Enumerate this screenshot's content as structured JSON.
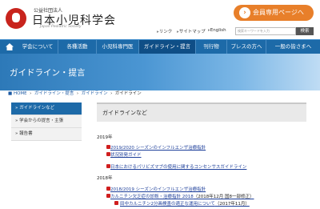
{
  "header": {
    "org_sub": "公益社団法人",
    "org_name": "日本小児科学会",
    "org_en": "Japan Pediatric Society",
    "members_button": "会員専用ページへ",
    "util_links": [
      "リンク",
      "サイトマップ",
      "English"
    ],
    "search_placeholder": "検索キーワードを入力",
    "search_button": "検索"
  },
  "nav": {
    "items": [
      "学会について",
      "各種活動",
      "小児科専門医",
      "ガイドライン・提言",
      "刊行物",
      "プレスの方へ",
      "一般の皆さまへ"
    ]
  },
  "banner": {
    "title": "ガイドライン・提言"
  },
  "breadcrumb": [
    "HOME",
    "ガイドライン・提言",
    "ガイドライン",
    "ガイドライン"
  ],
  "sidebar": {
    "items": [
      "ガイドラインなど",
      "学会からの提言・主張",
      "報告書"
    ]
  },
  "content": {
    "title": "ガイドラインなど",
    "sections": [
      {
        "year": "2019年",
        "entries": [
          {
            "link": "2019/2020 シーズンのインフルエンザ治療指針",
            "note": ""
          },
          {
            "link": "状況別発ガイド",
            "note": ""
          },
          {
            "link": "日本におけるパリビズマブの使用に関するコンセンサスガイドライン",
            "note": ""
          }
        ]
      },
      {
        "year": "2018年",
        "entries": [
          {
            "link": "2018/2019 シーズンのインフルエンザ治療指針",
            "note": ""
          },
          {
            "link": "カルニチン欠乏症の診断・治療指針 2018",
            "note": "（2018年12月 国8一部修正）"
          },
          {
            "link": "田中カルニチン2分画検査の適正な運用について",
            "note": "（2017年11月）"
          }
        ]
      }
    ]
  },
  "colors": {
    "nav": "#1d6aa8",
    "accent": "#e87f2a",
    "logo": "#c8241d"
  }
}
